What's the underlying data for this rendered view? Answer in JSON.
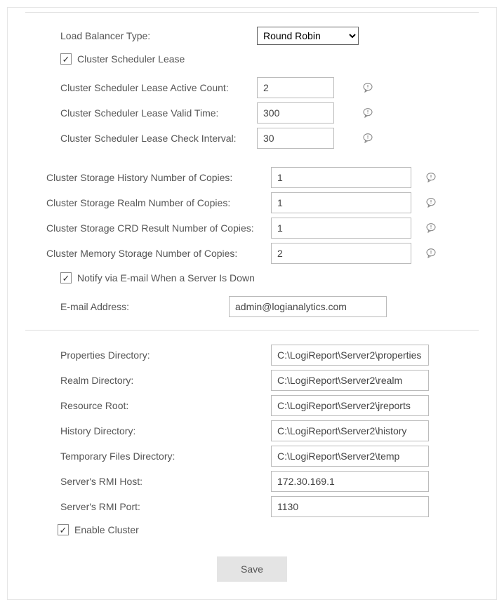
{
  "lb": {
    "label": "Load Balancer Type:",
    "value": "Round Robin"
  },
  "cluster_lease": {
    "label": "Cluster Scheduler Lease",
    "checked": true
  },
  "lease_active": {
    "label": "Cluster Scheduler Lease Active Count:",
    "value": "2"
  },
  "lease_valid": {
    "label": "Cluster Scheduler Lease Valid Time:",
    "value": "300"
  },
  "lease_check": {
    "label": "Cluster Scheduler Lease Check Interval:",
    "value": "30"
  },
  "copies_history": {
    "label": "Cluster Storage History Number of Copies:",
    "value": "1"
  },
  "copies_realm": {
    "label": "Cluster Storage Realm Number of Copies:",
    "value": "1"
  },
  "copies_crd": {
    "label": "Cluster Storage CRD Result Number of Copies:",
    "value": "1"
  },
  "copies_memory": {
    "label": "Cluster Memory Storage Number of Copies:",
    "value": "2"
  },
  "notify": {
    "label": "Notify via E-mail When a Server Is Down",
    "checked": true
  },
  "email": {
    "label": "E-mail Address:",
    "value": "admin@logianalytics.com"
  },
  "dir_props": {
    "label": "Properties Directory:",
    "value": "C:\\LogiReport\\Server2\\properties"
  },
  "dir_realm": {
    "label": "Realm Directory:",
    "value": "C:\\LogiReport\\Server2\\realm"
  },
  "dir_res": {
    "label": "Resource Root:",
    "value": "C:\\LogiReport\\Server2\\jreports"
  },
  "dir_hist": {
    "label": "History Directory:",
    "value": "C:\\LogiReport\\Server2\\history"
  },
  "dir_temp": {
    "label": "Temporary Files Directory:",
    "value": "C:\\LogiReport\\Server2\\temp"
  },
  "rmi_host": {
    "label": "Server's RMI Host:",
    "value": "172.30.169.1"
  },
  "rmi_port": {
    "label": "Server's RMI Port:",
    "value": "1130"
  },
  "enable_cluster": {
    "label": "Enable Cluster",
    "checked": true
  },
  "save_label": "Save"
}
